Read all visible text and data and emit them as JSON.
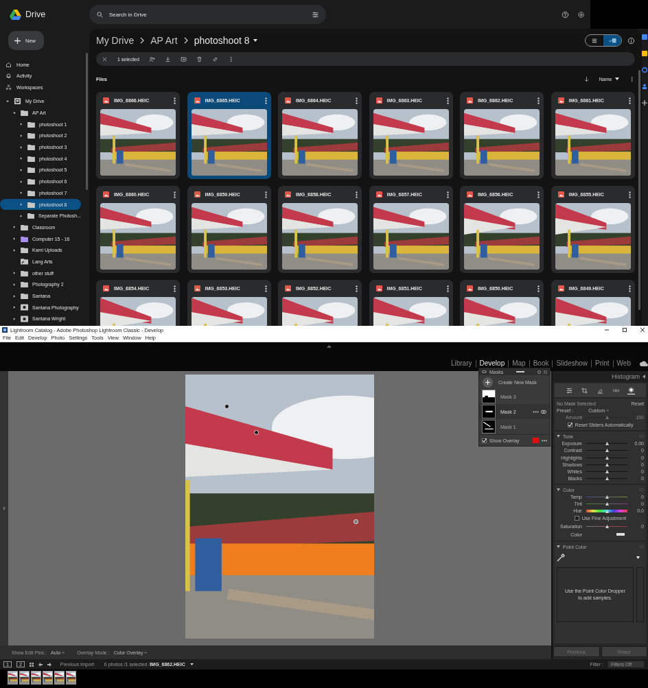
{
  "drive": {
    "logo": "Drive",
    "search": {
      "placeholder": "Search in Drive"
    },
    "new_button": "New",
    "nav": [
      {
        "label": "Home",
        "kind": "home"
      },
      {
        "label": "Activity",
        "kind": "activity"
      },
      {
        "label": "Workspaces",
        "kind": "workspaces"
      }
    ],
    "tree": [
      {
        "label": "My Drive",
        "kind": "drive",
        "color": "#c4c7c5",
        "expanded": true,
        "selected": false,
        "children": [
          {
            "label": "AP Art",
            "kind": "folder",
            "color": "#c4c7c5",
            "expanded": true,
            "selected": false,
            "children": [
              {
                "label": "photoshoot 1",
                "kind": "folder",
                "color": "#c4c7c5",
                "expanded": false,
                "selected": false
              },
              {
                "label": "photoshoot 2",
                "kind": "folder",
                "color": "#c4c7c5",
                "expanded": false,
                "selected": false
              },
              {
                "label": "photoshoot 3",
                "kind": "folder",
                "color": "#c4c7c5",
                "expanded": false,
                "selected": false
              },
              {
                "label": "photoshoot 4",
                "kind": "folder",
                "color": "#c4c7c5",
                "expanded": false,
                "selected": false
              },
              {
                "label": "photoshoot 5",
                "kind": "folder",
                "color": "#c4c7c5",
                "expanded": false,
                "selected": false
              },
              {
                "label": "photoshoot 6",
                "kind": "folder",
                "color": "#c4c7c5",
                "expanded": false,
                "selected": false
              },
              {
                "label": "photoshoot 7",
                "kind": "folder",
                "color": "#c4c7c5",
                "expanded": false,
                "selected": false
              },
              {
                "label": "photoshoot 8",
                "kind": "folder",
                "color": "#c4c7c5",
                "expanded": false,
                "selected": true
              },
              {
                "label": "Separate Photosh...",
                "kind": "folder",
                "color": "#c4c7c5",
                "expanded": false,
                "selected": false
              }
            ]
          },
          {
            "label": "Classroom",
            "kind": "folder",
            "color": "#c4c7c5",
            "expanded": false,
            "selected": false
          },
          {
            "label": "Computer 15 - 16",
            "kind": "folder",
            "color": "#a98ef0",
            "expanded": false,
            "selected": false
          },
          {
            "label": "Kami Uploads",
            "kind": "folder",
            "color": "#c4c7c5",
            "expanded": false,
            "selected": false
          },
          {
            "label": "Lang Arts",
            "kind": "shortcut",
            "color": "#c4c7c5",
            "selected": false
          },
          {
            "label": "other stuff",
            "kind": "folder",
            "color": "#c4c7c5",
            "expanded": false,
            "selected": false
          },
          {
            "label": "Photography 2",
            "kind": "folder",
            "color": "#c4c7c5",
            "expanded": false,
            "selected": false
          },
          {
            "label": "Santana",
            "kind": "folder",
            "color": "#c4c7c5",
            "expanded": false,
            "selected": false
          },
          {
            "label": "Santana Photography",
            "kind": "shared",
            "color": "#c4c7c5",
            "expanded": false,
            "selected": false
          },
          {
            "label": "Santana Wright",
            "kind": "shared",
            "color": "#c4c7c5",
            "expanded": false,
            "selected": false
          }
        ]
      }
    ],
    "breadcrumb": [
      "My Drive",
      "AP Art",
      "photoshoot 8"
    ],
    "view": [
      {
        "kind": "list",
        "selected": false
      },
      {
        "kind": "grid",
        "selected": true
      }
    ],
    "selection": "1 selected",
    "section": "Files",
    "sort": "Name",
    "files": [
      {
        "name": "IMG_6866.HEIC",
        "selected": false
      },
      {
        "name": "IMG_6865.HEIC",
        "selected": true
      },
      {
        "name": "IMG_6864.HEIC",
        "selected": false
      },
      {
        "name": "IMG_6863.HEIC",
        "selected": false
      },
      {
        "name": "IMG_6862.HEIC",
        "selected": false
      },
      {
        "name": "IMG_6861.HEIC",
        "selected": false
      },
      {
        "name": "IMG_6860.HEIC",
        "selected": false
      },
      {
        "name": "IMG_6859.HEIC",
        "selected": false
      },
      {
        "name": "IMG_6858.HEIC",
        "selected": false
      },
      {
        "name": "IMG_6857.HEIC",
        "selected": false
      },
      {
        "name": "IMG_6856.HEIC",
        "selected": false
      },
      {
        "name": "IMG_6855.HEIC",
        "selected": false
      },
      {
        "name": "IMG_6854.HEIC",
        "selected": false
      },
      {
        "name": "IMG_6853.HEIC",
        "selected": false
      },
      {
        "name": "IMG_6852.HEIC",
        "selected": false
      },
      {
        "name": "IMG_6851.HEIC",
        "selected": false
      },
      {
        "name": "IMG_6850.HEIC",
        "selected": false
      },
      {
        "name": "IMG_6849.HEIC",
        "selected": false
      }
    ]
  },
  "lightroom": {
    "title": "Lightroom Catalog - Adobe Photoshop Lightroom Classic - Develop",
    "menu": [
      "File",
      "Edit",
      "Develop",
      "Photo",
      "Settings",
      "Tools",
      "View",
      "Window",
      "Help"
    ],
    "modules": [
      {
        "label": "Library",
        "selected": false
      },
      {
        "label": "Develop",
        "selected": true
      },
      {
        "label": "Map",
        "selected": false
      },
      {
        "label": "Book",
        "selected": false
      },
      {
        "label": "Slideshow",
        "selected": false
      },
      {
        "label": "Print",
        "selected": false
      },
      {
        "label": "Web",
        "selected": false
      }
    ],
    "masks": {
      "title": "Masks",
      "create": "Create New Mask",
      "items": [
        {
          "label": "Mask 3",
          "kind": "top",
          "selected": false
        },
        {
          "label": "Mask 2",
          "kind": "band",
          "selected": true
        },
        {
          "label": "Mask 1",
          "kind": "line",
          "selected": false
        }
      ],
      "overlay": {
        "label": "Show Overlay",
        "checked": true,
        "color": "#dd1111"
      }
    },
    "panel": {
      "title": "Histogram",
      "tools": [
        {
          "kind": "sliders",
          "selected": false
        },
        {
          "kind": "crop",
          "selected": false
        },
        {
          "kind": "heal",
          "selected": false
        },
        {
          "kind": "redeye",
          "selected": false
        },
        {
          "kind": "mask",
          "selected": true
        }
      ],
      "mask_status": "No Mask Selected",
      "reset": "Reset",
      "preset_label": "Preset :",
      "preset": "Custom ÷",
      "amount": {
        "label": "Amount",
        "value": "100",
        "level": 0.5,
        "kind": "plain",
        "disabled": true
      },
      "auto_reset": {
        "label": "Reset Sliders Automatically",
        "checked": true
      },
      "tone": {
        "title": "Tone",
        "sliders": [
          {
            "label": "Exposure",
            "value": "0.00",
            "level": 0.5,
            "kind": "plain",
            "disabled": false
          },
          {
            "label": "Contrast",
            "value": "0",
            "level": 0.5,
            "kind": "plain",
            "disabled": false
          },
          {
            "label": "Highlights",
            "value": "0",
            "level": 0.5,
            "kind": "plain",
            "disabled": false
          },
          {
            "label": "Shadows",
            "value": "0",
            "level": 0.5,
            "kind": "plain",
            "disabled": false
          },
          {
            "label": "Whites",
            "value": "0",
            "level": 0.5,
            "kind": "plain",
            "disabled": false
          },
          {
            "label": "Blacks",
            "value": "0",
            "level": 0.5,
            "kind": "plain",
            "disabled": false
          }
        ]
      },
      "color": {
        "title": "Color",
        "sliders": [
          {
            "label": "Temp",
            "value": "0",
            "level": 0.5,
            "kind": "temp",
            "disabled": false
          },
          {
            "label": "Tint",
            "value": "0",
            "level": 0.5,
            "kind": "tint",
            "disabled": false
          },
          {
            "label": "Hue",
            "value": "0.0",
            "level": 0.5,
            "kind": "hue",
            "disabled": false
          }
        ],
        "fine": {
          "label": "Use Fine Adjustment",
          "checked": false
        },
        "saturation": {
          "label": "Saturation",
          "value": "0",
          "level": 0.5,
          "kind": "sat",
          "disabled": false
        },
        "swatch_label": "Color"
      },
      "point_color": {
        "title": "Point Color",
        "hint": "Use the Point Color Dropper to add samples."
      },
      "buttons": [
        "Previous",
        "Reset"
      ]
    },
    "toolbar": {
      "pins_label": "Show Edit Pins :",
      "pins": "Auto ÷",
      "overlay_label": "Overlay Mode :",
      "overlay": "Color Overlay ÷"
    },
    "filmstrip": {
      "views": [
        "1",
        "2"
      ],
      "source": "Previous Import",
      "info": "6 photos /1 selected /",
      "file": "IMG_6862.HEIC",
      "filter_label": "Filter :",
      "filter": "Filters Off",
      "thumbs": [
        {
          "kind": "picture"
        },
        {
          "kind": "picture"
        },
        {
          "kind": "picture"
        },
        {
          "kind": "picture"
        },
        {
          "kind": "picture"
        },
        {
          "kind": "picture"
        }
      ]
    }
  }
}
